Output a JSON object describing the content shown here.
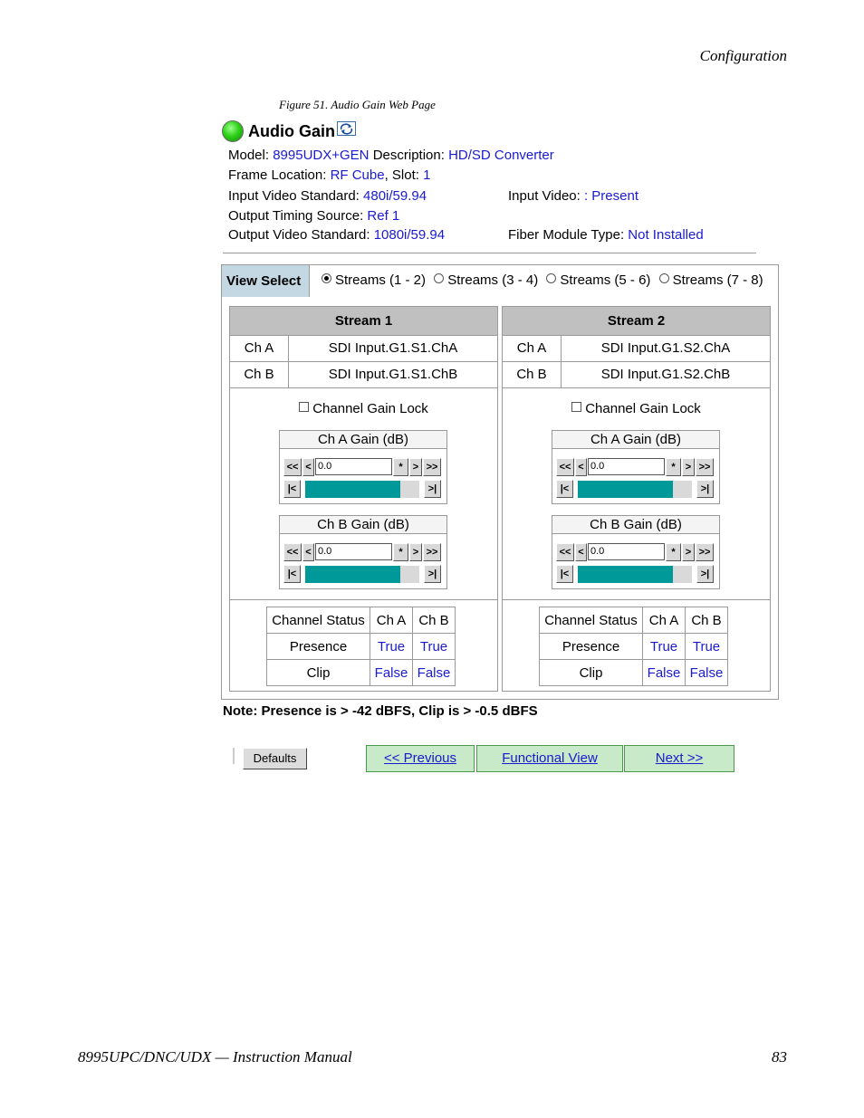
{
  "page": {
    "header": "Configuration",
    "caption": "Figure 51.  Audio Gain Web Page",
    "footer_left": "8995UPC/DNC/UDX — Instruction Manual",
    "footer_right": "83"
  },
  "title": "Audio Gain",
  "icons": {
    "status": "green-status-led",
    "refresh": "refresh-icon"
  },
  "info": {
    "model_label": "Model:",
    "model": "8995UDX+GEN",
    "description_label": "Description:",
    "description": "HD/SD Converter",
    "frame_label": "Frame Location:",
    "frame": "RF Cube",
    "slot_label": ", Slot:",
    "slot": "1",
    "input_std_label": "Input Video Standard:",
    "input_std": "480i/59.94",
    "input_video_label": "Input Video:",
    "input_video": ": Present",
    "timing_label": "Output Timing Source:",
    "timing": "Ref 1",
    "output_std_label": "Output Video Standard:",
    "output_std": "1080i/59.94",
    "fiber_label": "Fiber Module Type:",
    "fiber": "Not Installed"
  },
  "view_select": {
    "label": "View Select",
    "options": [
      "Streams (1 - 2)",
      "Streams (3 - 4)",
      "Streams (5 - 6)",
      "Streams (7 - 8)"
    ],
    "selected": 0
  },
  "streams": [
    {
      "name": "Stream 1",
      "channels": [
        {
          "name": "Ch A",
          "source": "SDI Input.G1.S1.ChA"
        },
        {
          "name": "Ch B",
          "source": "SDI Input.G1.S1.ChB"
        }
      ],
      "lock_label": "Channel Gain Lock",
      "gains": [
        {
          "title": "Ch A Gain (dB)",
          "value": "0.0",
          "level": 0.83
        },
        {
          "title": "Ch B Gain (dB)",
          "value": "0.0",
          "level": 0.83
        }
      ],
      "status": {
        "header": [
          "Channel Status",
          "Ch A",
          "Ch B"
        ],
        "rows": [
          {
            "label": "Presence",
            "a": "True",
            "b": "True"
          },
          {
            "label": "Clip",
            "a": "False",
            "b": "False"
          }
        ]
      }
    },
    {
      "name": "Stream 2",
      "channels": [
        {
          "name": "Ch A",
          "source": "SDI Input.G1.S2.ChA"
        },
        {
          "name": "Ch B",
          "source": "SDI Input.G1.S2.ChB"
        }
      ],
      "lock_label": "Channel Gain Lock",
      "gains": [
        {
          "title": "Ch A Gain (dB)",
          "value": "0.0",
          "level": 0.83
        },
        {
          "title": "Ch B Gain (dB)",
          "value": "0.0",
          "level": 0.83
        }
      ],
      "status": {
        "header": [
          "Channel Status",
          "Ch A",
          "Ch B"
        ],
        "rows": [
          {
            "label": "Presence",
            "a": "True",
            "b": "True"
          },
          {
            "label": "Clip",
            "a": "False",
            "b": "False"
          }
        ]
      }
    }
  ],
  "gain_buttons": {
    "dec_big": "<<",
    "dec": "<",
    "reset": "*",
    "inc": ">",
    "inc_big": ">>",
    "min": "|<",
    "max": ">|"
  },
  "note": "Note: Presence is > -42 dBFS, Clip is > -0.5 dBFS",
  "buttons": {
    "defaults": "Defaults",
    "previous": "<< Previous",
    "functional": "Functional View",
    "next": "Next >>"
  },
  "colors": {
    "link": "#1a1ad0",
    "bar_fill": "#009999",
    "nav_bg": "#c8eac8",
    "view_select_bg": "#c3d8e3"
  }
}
